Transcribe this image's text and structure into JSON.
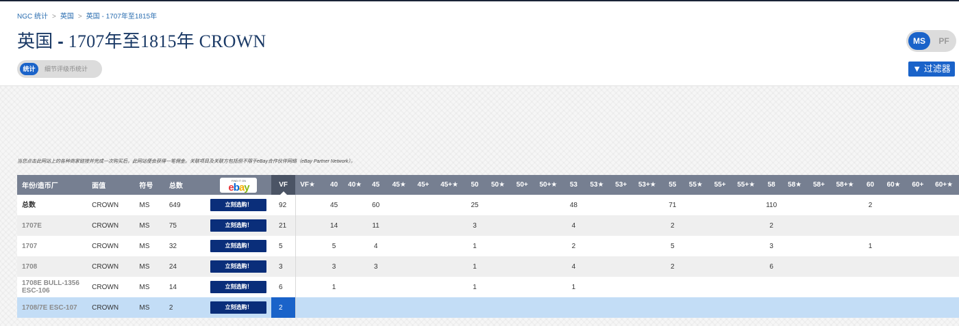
{
  "breadcrumb": [
    "NGC 统计",
    "英国",
    "英国 - 1707年至1815年"
  ],
  "page_title": {
    "prefix": "英国 ",
    "dash": "-",
    "suffix": " 1707年至1815年 CROWN"
  },
  "tabs": {
    "active": "统计",
    "inactive": "细节评级币统计"
  },
  "toggle": {
    "ms": "MS",
    "pf": "PF"
  },
  "filter_button": "▼ 过滤器",
  "disclaimer": "当您点击此网站上的各种商家链接并完成一次购买后，此网站便会获得一笔佣金。关联项目及关联方包括但不限于eBay合作伙伴网络（eBay Partner Network）。",
  "ebay": {
    "find": "FIND IT ON",
    "letters": [
      "e",
      "b",
      "a",
      "y"
    ],
    "colors": [
      "#e53238",
      "#0064d2",
      "#f5af02",
      "#86b817"
    ]
  },
  "buy_label": "立刻选购！",
  "columns": [
    "年份/造币厂",
    "面值",
    "符号",
    "总数",
    "",
    "VF",
    "VF★",
    "40",
    "40★",
    "45",
    "45★",
    "45+",
    "45+★",
    "50",
    "50★",
    "50+",
    "50+★",
    "53",
    "53★",
    "53+",
    "53+★",
    "55",
    "55★",
    "55+",
    "55+★",
    "58",
    "58★",
    "58+",
    "58+★",
    "60",
    "60★",
    "60+",
    "60+★"
  ],
  "rows": [
    {
      "year": "总数",
      "denom": "CROWN",
      "symbol": "MS",
      "total": "649",
      "grades": [
        "92",
        "",
        "45",
        "",
        "60",
        "",
        "",
        "",
        "25",
        "",
        "",
        "",
        "48",
        "",
        "",
        "",
        "71",
        "",
        "",
        "",
        "110",
        "",
        "",
        "",
        "2",
        "",
        "",
        ""
      ]
    },
    {
      "year": "1707E",
      "denom": "CROWN",
      "symbol": "MS",
      "total": "75",
      "grades": [
        "21",
        "",
        "14",
        "",
        "11",
        "",
        "",
        "",
        "3",
        "",
        "",
        "",
        "4",
        "",
        "",
        "",
        "2",
        "",
        "",
        "",
        "2",
        "",
        "",
        "",
        "",
        "",
        "",
        ""
      ]
    },
    {
      "year": "1707",
      "denom": "CROWN",
      "symbol": "MS",
      "total": "32",
      "grades": [
        "5",
        "",
        "5",
        "",
        "4",
        "",
        "",
        "",
        "1",
        "",
        "",
        "",
        "2",
        "",
        "",
        "",
        "5",
        "",
        "",
        "",
        "3",
        "",
        "",
        "",
        "1",
        "",
        "",
        ""
      ]
    },
    {
      "year": "1708",
      "denom": "CROWN",
      "symbol": "MS",
      "total": "24",
      "grades": [
        "3",
        "",
        "3",
        "",
        "3",
        "",
        "",
        "",
        "1",
        "",
        "",
        "",
        "4",
        "",
        "",
        "",
        "2",
        "",
        "",
        "",
        "6",
        "",
        "",
        "",
        "",
        "",
        "",
        ""
      ]
    },
    {
      "year": "1708E BULL-1356 ESC-106",
      "denom": "CROWN",
      "symbol": "MS",
      "total": "14",
      "grades": [
        "6",
        "",
        "1",
        "",
        "",
        "",
        "",
        "",
        "1",
        "",
        "",
        "",
        "1",
        "",
        "",
        "",
        "",
        "",
        "",
        "",
        "",
        "",
        "",
        "",
        "",
        "",
        "",
        ""
      ]
    },
    {
      "year": "1708/7E ESC-107",
      "denom": "CROWN",
      "symbol": "MS",
      "total": "2",
      "grades": [
        "2",
        "",
        "",
        "",
        "",
        "",
        "",
        "",
        "",
        "",
        "",
        "",
        "",
        "",
        "",
        "",
        "",
        "",
        "",
        "",
        "",
        "",
        "",
        "",
        "",
        "",
        "",
        ""
      ]
    }
  ],
  "selected_row": 5,
  "colors": {
    "accent": "#1a63c9",
    "header": "#767f91",
    "vf_header": "#4b5465",
    "selected": "#c3ddf6",
    "buy": "#0a2e7a"
  }
}
